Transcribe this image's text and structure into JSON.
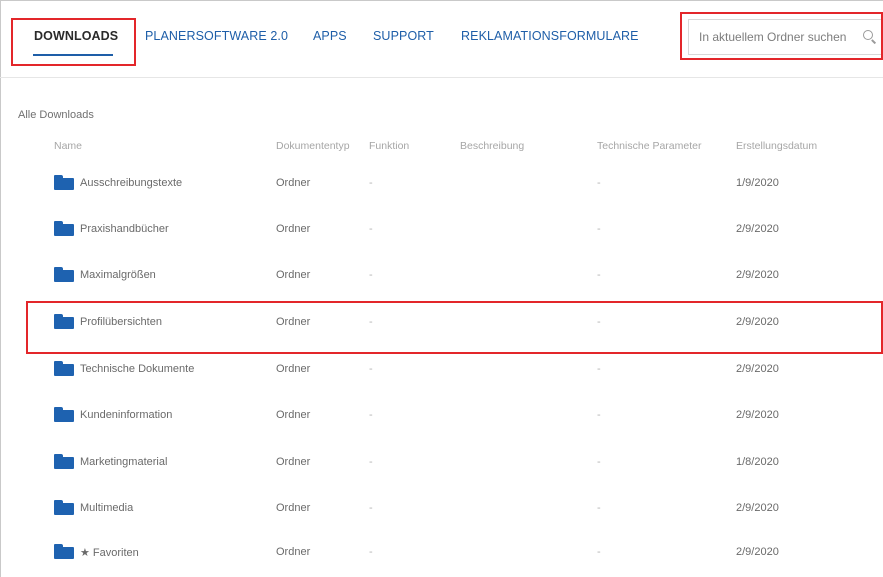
{
  "nav": {
    "tabs": [
      {
        "label": "DOWNLOADS",
        "active": true
      },
      {
        "label": "PLANERSOFTWARE 2.0"
      },
      {
        "label": "APPS"
      },
      {
        "label": "SUPPORT"
      },
      {
        "label": "REKLAMATIONSFORMULARE"
      }
    ],
    "search_placeholder": "In aktuellem Ordner suchen"
  },
  "breadcrumb": "Alle Downloads",
  "table": {
    "columns": [
      "Name",
      "Dokumententyp",
      "Funktion",
      "Beschreibung",
      "Technische Parameter",
      "Erstellungsdatum"
    ],
    "rows": [
      {
        "name": "Ausschreibungstexte",
        "type": "Ordner",
        "function": "-",
        "tech": "-",
        "date": "1/9/2020"
      },
      {
        "name": "Praxishandbücher",
        "type": "Ordner",
        "function": "-",
        "tech": "-",
        "date": "2/9/2020"
      },
      {
        "name": "Maximalgrößen",
        "type": "Ordner",
        "function": "-",
        "tech": "-",
        "date": "2/9/2020"
      },
      {
        "name": "Profilübersichten",
        "type": "Ordner",
        "function": "-",
        "tech": "-",
        "date": "2/9/2020"
      },
      {
        "name": "Technische Dokumente",
        "type": "Ordner",
        "function": "-",
        "tech": "-",
        "date": "2/9/2020"
      },
      {
        "name": "Kundeninformation",
        "type": "Ordner",
        "function": "-",
        "tech": "-",
        "date": "2/9/2020"
      },
      {
        "name": "Marketingmaterial",
        "type": "Ordner",
        "function": "-",
        "tech": "-",
        "date": "1/8/2020"
      },
      {
        "name": "Multimedia",
        "type": "Ordner",
        "function": "-",
        "tech": "-",
        "date": "2/9/2020"
      },
      {
        "name": "★ Favoriten",
        "type": "Ordner",
        "function": "-",
        "tech": "-",
        "date": "2/9/2020"
      }
    ]
  },
  "icons": {
    "folder": "folder-icon",
    "search": "search-icon"
  },
  "colors": {
    "accent": "#1e5ea8",
    "folder": "#1e62b0",
    "highlight": "#e3262a"
  }
}
